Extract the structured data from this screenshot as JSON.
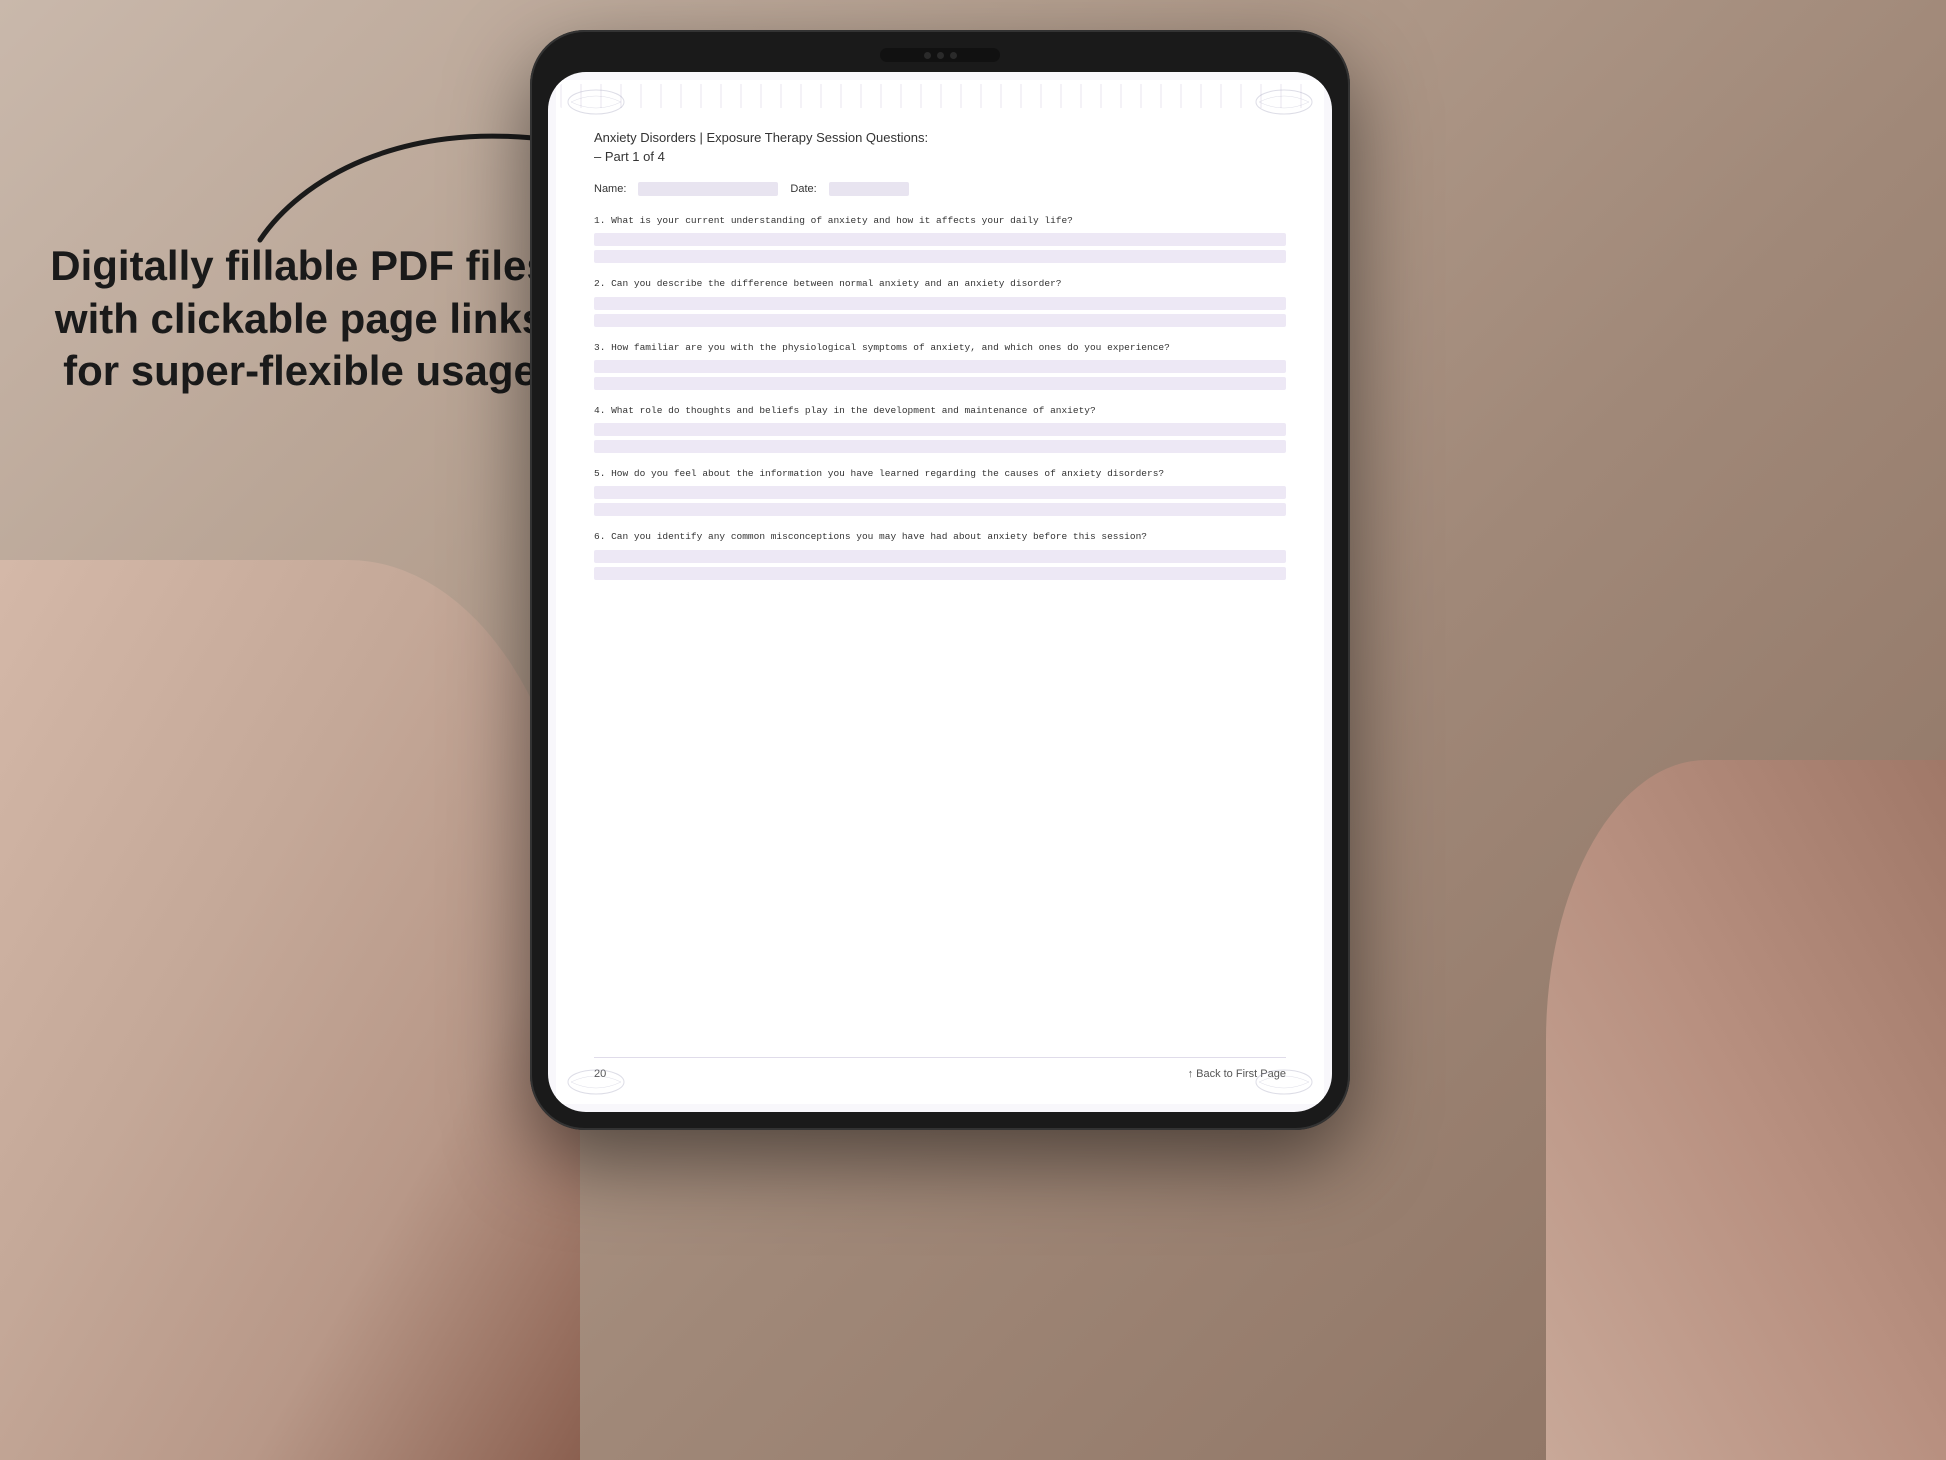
{
  "background": {
    "color1": "#c9b8ab",
    "color2": "#8b7060"
  },
  "promoText": {
    "line1": "Digitally fillable PDF files",
    "line2": "with clickable page links",
    "line3": "for super-flexible usage"
  },
  "arrow": {
    "label": "arrow pointing to tablet"
  },
  "tablet": {
    "screen": {
      "pdf": {
        "title": "Anxiety Disorders | Exposure Therapy Session Questions:",
        "subtitle": "– Part 1 of 4",
        "nameLabel": "Name:",
        "dateLabel": "Date:",
        "questions": [
          {
            "number": "1.",
            "text": "What is your current understanding of anxiety and how it affects your daily life?",
            "answerLines": 2
          },
          {
            "number": "2.",
            "text": "Can you describe the difference between normal anxiety and an anxiety disorder?",
            "answerLines": 2
          },
          {
            "number": "3.",
            "text": "How familiar are you with the physiological symptoms of anxiety, and which ones do you experience?",
            "answerLines": 2
          },
          {
            "number": "4.",
            "text": "What role do thoughts and beliefs play in the development and maintenance of anxiety?",
            "answerLines": 2
          },
          {
            "number": "5.",
            "text": "How do you feel about the information you have learned regarding the causes of anxiety disorders?",
            "answerLines": 2
          },
          {
            "number": "6.",
            "text": "Can you identify any common misconceptions you may have had about anxiety before this session?",
            "answerLines": 2
          }
        ],
        "footer": {
          "pageNumber": "20",
          "backLink": "↑ Back to First Page"
        }
      }
    }
  }
}
